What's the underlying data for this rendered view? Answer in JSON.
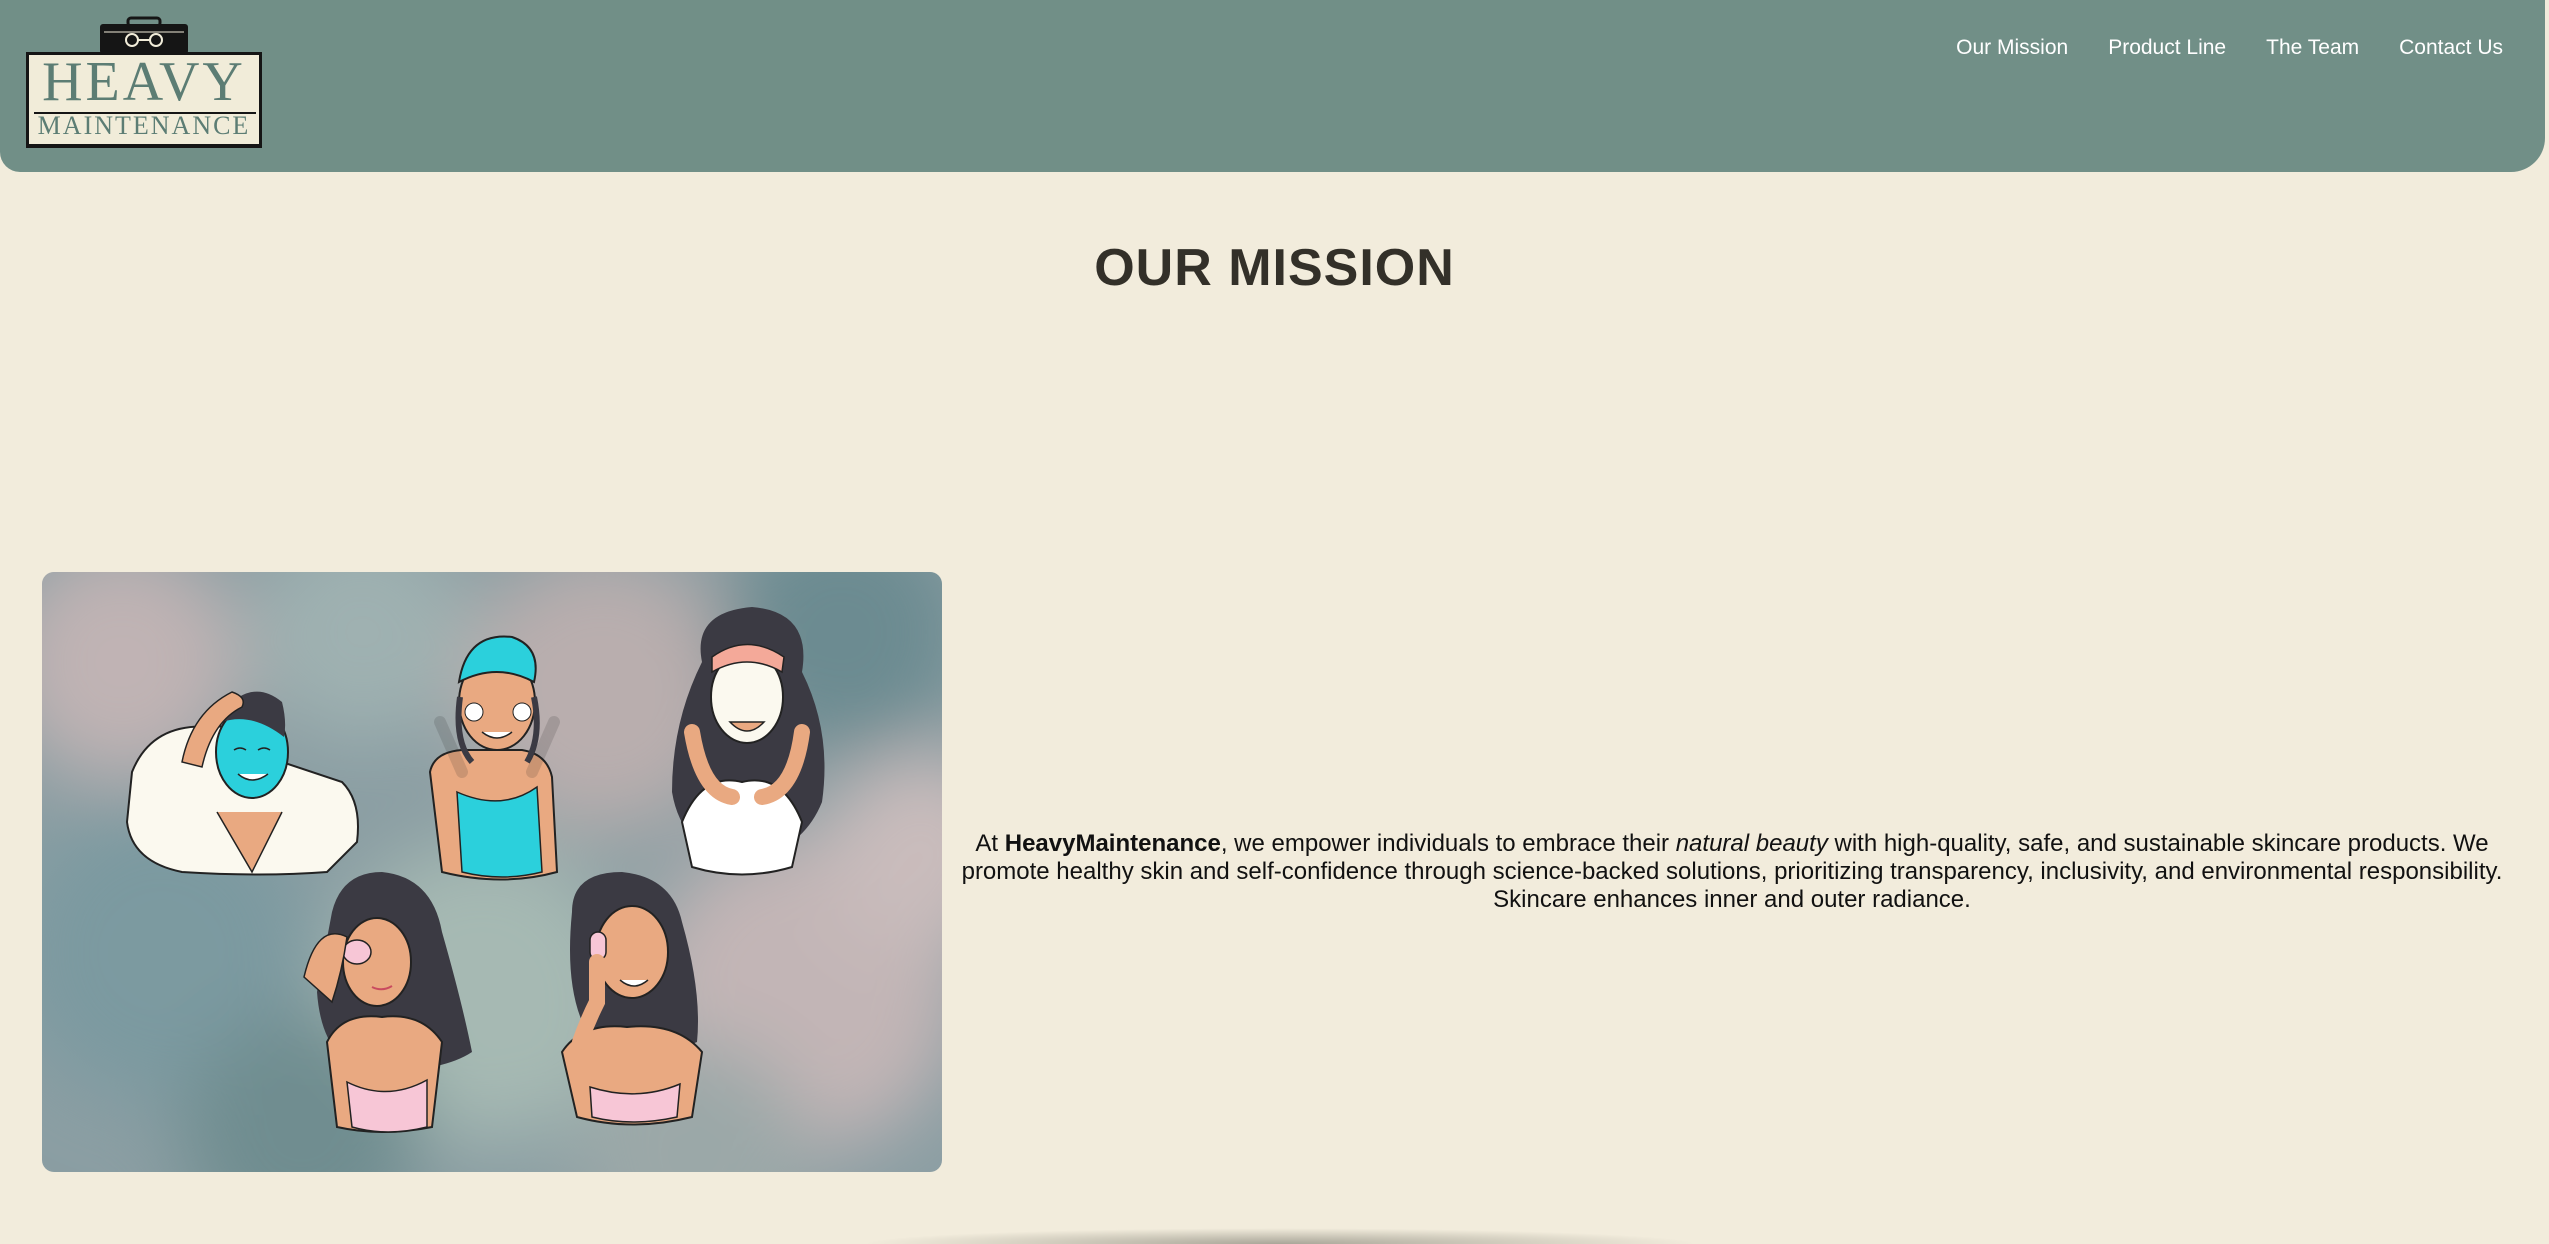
{
  "logo": {
    "line1": "HEAVY",
    "line2": "MAINTENANCE",
    "emblem_icon": "vanity-case-icon"
  },
  "nav": {
    "items": [
      {
        "label": "Our Mission"
      },
      {
        "label": "Product Line"
      },
      {
        "label": "The Team"
      },
      {
        "label": "Contact Us"
      }
    ]
  },
  "page": {
    "title": "OUR MISSION"
  },
  "mission": {
    "prefix": "At ",
    "brand": "HeavyMaintenance",
    "middle": ", we empower individuals to embrace their ",
    "emphasis": "natural beauty",
    "suffix": " with high-quality, safe, and sustainable skincare products. We promote healthy skin and self-confidence through science-backed solutions, prioritizing transparency, inclusivity, and environmental responsibility. Skincare enhances inner and outer radiance."
  },
  "illustration": {
    "subject": "women-skincare-illustration"
  },
  "colors": {
    "header": "#718f87",
    "background": "#f2ecdc",
    "title": "#333029",
    "accent_teal": "#2bd0dc",
    "accent_pink": "#f7c6d6",
    "skin": "#e9a981"
  }
}
